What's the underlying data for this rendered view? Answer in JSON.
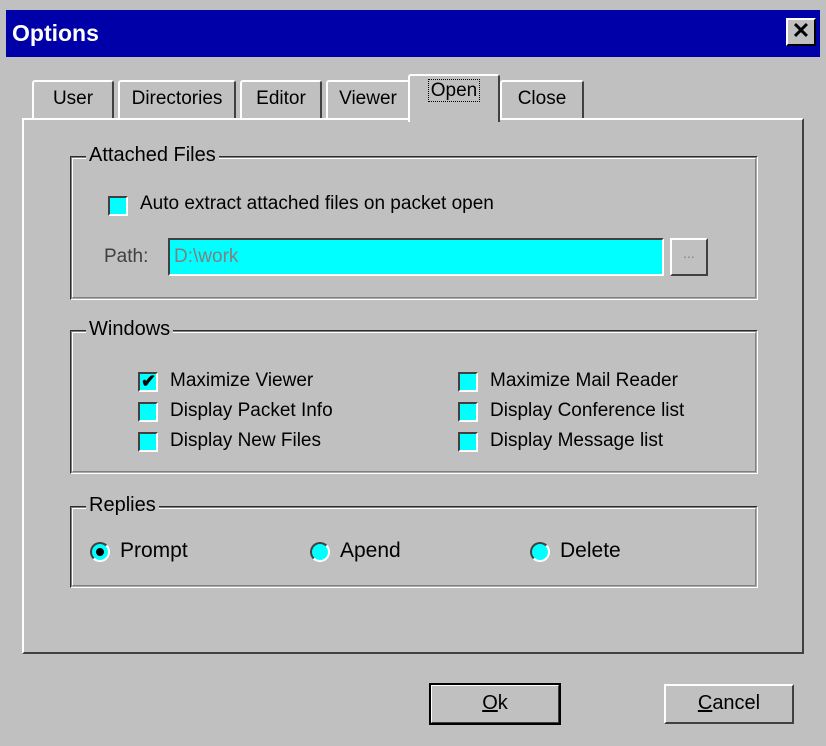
{
  "window": {
    "title": "Options",
    "close_glyph": "✕",
    "close_icon": "close-icon"
  },
  "tabs": [
    {
      "label": "User"
    },
    {
      "label": "Directories"
    },
    {
      "label": "Editor"
    },
    {
      "label": "Viewer"
    },
    {
      "label": "Open",
      "active": true
    },
    {
      "label": "Close"
    }
  ],
  "attached_files": {
    "title": "Attached Files",
    "auto_extract_label": "Auto extract attached files on packet open",
    "auto_extract_checked": false,
    "path_label": "Path:",
    "path_value": "D:\\work",
    "browse_label": "..."
  },
  "windows_group": {
    "title": "Windows",
    "options": [
      {
        "label": "Maximize Viewer",
        "checked": true
      },
      {
        "label": "Display Packet Info",
        "checked": false
      },
      {
        "label": "Display New Files",
        "checked": false
      },
      {
        "label": "Maximize Mail Reader",
        "checked": false
      },
      {
        "label": "Display Conference list",
        "checked": false
      },
      {
        "label": "Display Message list",
        "checked": false
      }
    ]
  },
  "replies": {
    "title": "Replies",
    "options": [
      {
        "label": "Prompt",
        "selected": true
      },
      {
        "label": "Apend",
        "selected": false
      },
      {
        "label": "Delete",
        "selected": false
      }
    ]
  },
  "buttons": {
    "ok_mnemonic": "O",
    "ok_rest": "k",
    "cancel_mnemonic": "C",
    "cancel_rest": "ancel"
  },
  "colors": {
    "titlebar": "#0000a8",
    "field": "#00ffff",
    "face": "#c0c0c0"
  }
}
